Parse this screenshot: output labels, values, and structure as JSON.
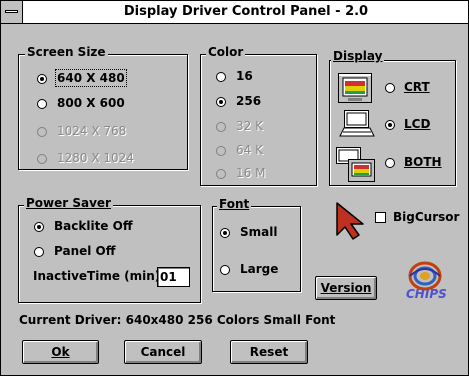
{
  "window": {
    "title": "Display Driver Control Panel - 2.0"
  },
  "screen_size": {
    "label": "Screen Size",
    "options": [
      {
        "label": "640 X 480",
        "selected": true,
        "enabled": true
      },
      {
        "label": "800 X 600",
        "selected": false,
        "enabled": true
      },
      {
        "label": "1024 X 768",
        "selected": false,
        "enabled": false
      },
      {
        "label": "1280 X 1024",
        "selected": false,
        "enabled": false
      }
    ]
  },
  "color": {
    "label": "Color",
    "options": [
      {
        "label": "16",
        "selected": false,
        "enabled": true
      },
      {
        "label": "256",
        "selected": true,
        "enabled": true
      },
      {
        "label": "32 K",
        "selected": false,
        "enabled": false
      },
      {
        "label": "64 K",
        "selected": false,
        "enabled": false
      },
      {
        "label": "16 M",
        "selected": false,
        "enabled": false
      }
    ]
  },
  "display": {
    "label": "Display",
    "options": [
      {
        "label": "CRT",
        "selected": false,
        "icon": "crt-monitor-icon"
      },
      {
        "label": "LCD",
        "selected": true,
        "icon": "laptop-lcd-icon"
      },
      {
        "label": "BOTH",
        "selected": false,
        "icon": "both-displays-icon"
      }
    ]
  },
  "power_saver": {
    "label": "Power Saver",
    "options": [
      {
        "label": "Backlite Off",
        "selected": true
      },
      {
        "label": "Panel Off",
        "selected": false
      }
    ],
    "inactive_time_label": "InactiveTime (min):",
    "inactive_time_value": "01"
  },
  "font": {
    "label": "Font",
    "options": [
      {
        "label": "Small",
        "selected": true
      },
      {
        "label": "Large",
        "selected": false
      }
    ]
  },
  "big_cursor": {
    "label": "BigCursor",
    "checked": false,
    "icon": "arrow-cursor-icon"
  },
  "version_button": {
    "label": "Version"
  },
  "logo": {
    "text": "CHIPS",
    "icon": "chips-logo-icon"
  },
  "status": {
    "text": "Current Driver: 640x480 256 Colors Small Font"
  },
  "buttons": {
    "ok": "Ok",
    "cancel": "Cancel",
    "reset": "Reset"
  },
  "colors": {
    "face": "#c0c0c0",
    "shadow": "#808080",
    "highlight": "#ffffff",
    "cursor_red": "#c03020"
  }
}
